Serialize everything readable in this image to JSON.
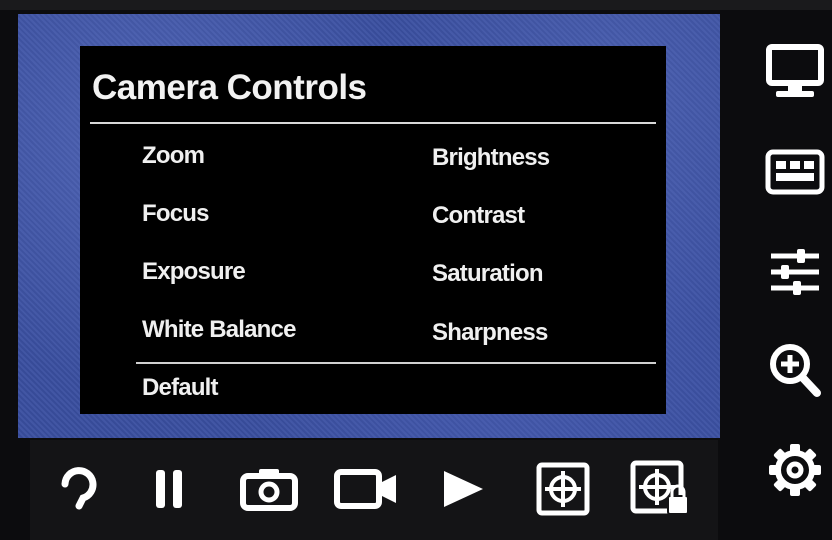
{
  "menu": {
    "title": "Camera Controls",
    "left_items": [
      {
        "label": "Zoom"
      },
      {
        "label": "Focus"
      },
      {
        "label": "Exposure"
      },
      {
        "label": "White Balance"
      }
    ],
    "right_items": [
      {
        "label": "Brightness"
      },
      {
        "label": "Contrast"
      },
      {
        "label": "Saturation"
      },
      {
        "label": "Sharpness"
      }
    ],
    "footer_item": {
      "label": "Default"
    }
  },
  "toolbar": {
    "icons": [
      "rotate-icon",
      "pause-icon",
      "camera-icon",
      "video-camera-icon",
      "play-icon",
      "crosshair-icon",
      "crosshair-lock-icon"
    ]
  },
  "sidebar": {
    "icons": [
      "monitor-icon",
      "grid-icon",
      "sliders-icon",
      "zoom-in-icon",
      "gear-icon"
    ]
  },
  "colors": {
    "viewport_blue": "#3a4fa0",
    "menu_background": "#000000",
    "text": "#f0f0f0",
    "icon": "#ffffff"
  }
}
